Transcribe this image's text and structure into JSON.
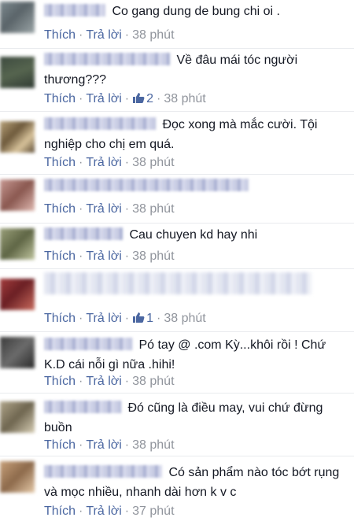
{
  "labels": {
    "like": "Thích",
    "reply": "Trả lời",
    "separator": "·"
  },
  "colors": {
    "link": "#4b67a1",
    "meta": "#90949c",
    "text": "#141823"
  },
  "comments": [
    {
      "author_visible": "",
      "text": "Co gang dung de bung chi oi .",
      "like_count": "",
      "time": "38 phút"
    },
    {
      "author_visible": "",
      "text": "Về đâu mái tóc người thương???",
      "like_count": "2",
      "time": "38 phút"
    },
    {
      "author_visible": "",
      "text": "Đọc xong mà mắc cười. Tội nghiệp cho chị em quá.",
      "like_count": "",
      "time": "38 phút"
    },
    {
      "author_visible": "",
      "text": "",
      "like_count": "",
      "time": "38 phút"
    },
    {
      "author_visible": "",
      "text": "Cau chuyen kd hay nhi",
      "like_count": "",
      "time": "38 phút"
    },
    {
      "author_visible": "",
      "text": "",
      "like_count": "1",
      "time": "38 phút"
    },
    {
      "author_visible": "",
      "text": "Pó tay @ .com Kỳ...khôi rồi ! Chứ K.D cái nỗi gì nữa .hihi!",
      "like_count": "",
      "time": "38 phút"
    },
    {
      "author_visible": "",
      "text": "Đó cũng là điều may, vui chứ đừng buồn",
      "like_count": "",
      "time": "38 phút"
    },
    {
      "author_visible": "",
      "text": "Có sản phẩm nào tóc bớt rụng và mọc nhiều, nhanh dài hơn k v c",
      "like_count": "",
      "time": "37 phút"
    }
  ]
}
